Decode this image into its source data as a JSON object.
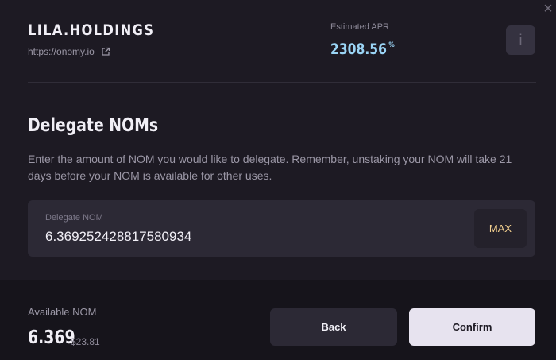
{
  "header": {
    "validator_name": "LILA.HOLDINGS",
    "website": "https://onomy.io",
    "apr_label": "Estimated APR",
    "apr_value": "2308.56",
    "apr_unit": "%",
    "info_label": "i",
    "close_label": "×"
  },
  "main": {
    "title": "Delegate NOMs",
    "description": "Enter the amount of NOM you would like to delegate. Remember, unstaking your NOM will take 21 days before your NOM is available for other uses.",
    "input": {
      "label": "Delegate NOM",
      "value": "6.369252428817580934"
    },
    "max_label": "MAX"
  },
  "footer": {
    "available_label": "Available NOM",
    "available_amount": "6.369",
    "available_usd": "$23.81",
    "back_label": "Back",
    "confirm_label": "Confirm"
  },
  "colors": {
    "background": "#1d1a23",
    "apr_accent": "#9ad4f5",
    "max_accent": "#f2cf8e",
    "confirm_bg": "#e7e3ef"
  }
}
